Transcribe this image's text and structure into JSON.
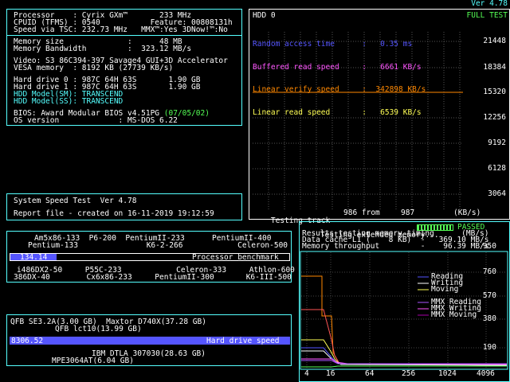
{
  "version": "Ver 4.78",
  "sysinfo": {
    "processor": "Processor    : Cyrix GXm™       233 MHz",
    "cpuid": "CPUID (TFMS) : 0540           Feature: 00808131h",
    "tsc": "Speed via TSC: 232.73 MHz   MMX™:Yes 3DNow!™:No",
    "memsize": "Memory size              :      48 MB",
    "membw": "Memory Bandwidth         :  323.12 MB/s",
    "video": "Video: S3 86C394-397 Savage4 GUI+3D Accelerator",
    "vesa": "VESA memory  : 8192 KB (27739 KB/s)",
    "hd0": "Hard drive 0 : 987C 64H 63S       1.90 GB",
    "hd1": "Hard drive 1 : 987C 64H 63S       1.90 GB",
    "hddm": "HDD Model(SM): TRANSCEND",
    "hdds": "HDD Model(SS): TRANSCEND",
    "bios": "BIOS: Award Modular BIOS v4.51PG ",
    "bios_date": "(07/05/02)",
    "os": "OS version             : MS-DOS 6.22"
  },
  "speedtest": {
    "title": "System Speed Test  Ver 4.78",
    "report": "Report file - created on 16-11-2019 19:12:59"
  },
  "hdd": {
    "label": "HDD 0",
    "status": "FULL TEST",
    "rat": "Random access time      :   0.35 ms",
    "brs": "Buffered read speed     :   6661 KB/s",
    "lvs": "Linear verify speed     :  342898 KB/s",
    "lrs": "Linear read speed       :   6539 KB/s",
    "yticks": [
      "21448",
      "18384",
      "15320",
      "12256",
      "9192",
      "6128",
      "3064"
    ],
    "footer_left": "Testing track",
    "footer_mid": "986 from",
    "footer_mid2": "987",
    "footer_unit": "(KB/s)"
  },
  "cpu_bench": {
    "top1": "Am5x86-133  P6-200  PentiumII-233      PentiumII-400",
    "top2": "Pentium-133               K6-2-266            Celeron-500",
    "value": "134.14",
    "label": "Processor benchmark",
    "bot1": "i486DX2-50     P55C-233            Celeron-333     Athlon-600",
    "bot2": "386DX-40        Cx6x86-233     PentiumII-300       K6-III-500"
  },
  "hd_bench": {
    "top1": "QFB SE3.2A(3.00 GB)  Maxtor D740X(37.28 GB)",
    "top2": "QFB lct10(13.99 GB)",
    "value": "8306.52",
    "label": "Hard drive speed",
    "bot1": "IBM DTLA 307030(28.63 GB)",
    "bot2": "MPE3064AT(6.04 GB)"
  },
  "memtest": {
    "line1": "Testing extended memory...",
    "passed": "PASSED",
    "line2": "Results testing memory-timing      (MB/s)",
    "line3": "Data cache L1 (    8 KB)  -   369.10 MB/s",
    "line4": "Memory throughput         -    96.39 MB/s",
    "ymax": "950",
    "yticks": [
      "760",
      "570",
      "380",
      "190"
    ],
    "xticks": [
      "4",
      "16",
      "64",
      "256",
      "1024",
      "4096"
    ],
    "legend": [
      {
        "name": "Reading",
        "color": "#55f"
      },
      {
        "name": "Writing",
        "color": "#fff"
      },
      {
        "name": "Moving",
        "color": "#ff5"
      },
      {
        "name": "MMX Reading",
        "color": "#a5f"
      },
      {
        "name": "MMX Writing",
        "color": "#f5f"
      },
      {
        "name": "MMX Moving",
        "color": "#a0a"
      }
    ]
  }
}
